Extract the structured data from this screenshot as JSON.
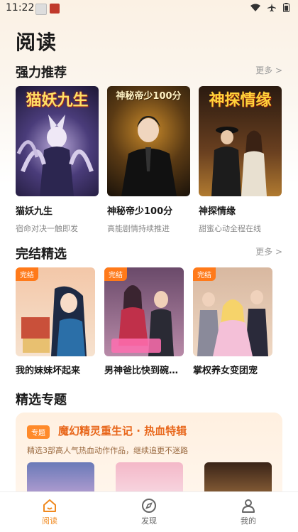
{
  "status": {
    "time": "11:22"
  },
  "page": {
    "title": "阅读"
  },
  "recommend": {
    "title": "强力推荐",
    "more": "更多 >",
    "items": [
      {
        "title": "猫妖九生",
        "subtitle": "宿命对决一触即发",
        "cover_text": "猫妖九生"
      },
      {
        "title": "神秘帝少100分",
        "subtitle": "高能剧情持续推进",
        "cover_text": "神秘帝少100分"
      },
      {
        "title": "神探情缘",
        "subtitle": "甜蜜心动全程在线",
        "cover_text": "神探情缘"
      }
    ]
  },
  "finished": {
    "title": "完结精选",
    "more": "更多 >",
    "items": [
      {
        "title": "我的妹妹坏起来",
        "badge": "完结"
      },
      {
        "title": "男神爸比快到碗…",
        "badge": "完结"
      },
      {
        "title": "掌权养女变团宠",
        "badge": "完结"
      }
    ]
  },
  "topics": {
    "title": "精选专题",
    "card": {
      "tag": "专题",
      "title": "魔幻精灵重生记 · 热血特辑",
      "desc": "精选3部高人气热血动作作品，继续追更不迷路"
    }
  },
  "nav": {
    "items": [
      {
        "label": "阅读",
        "icon": "home-icon",
        "active": true
      },
      {
        "label": "发现",
        "icon": "compass-icon",
        "active": false
      },
      {
        "label": "我的",
        "icon": "person-icon",
        "active": false
      }
    ]
  },
  "colors": {
    "accent": "#ff7a1a",
    "active_nav": "#f0891f"
  }
}
